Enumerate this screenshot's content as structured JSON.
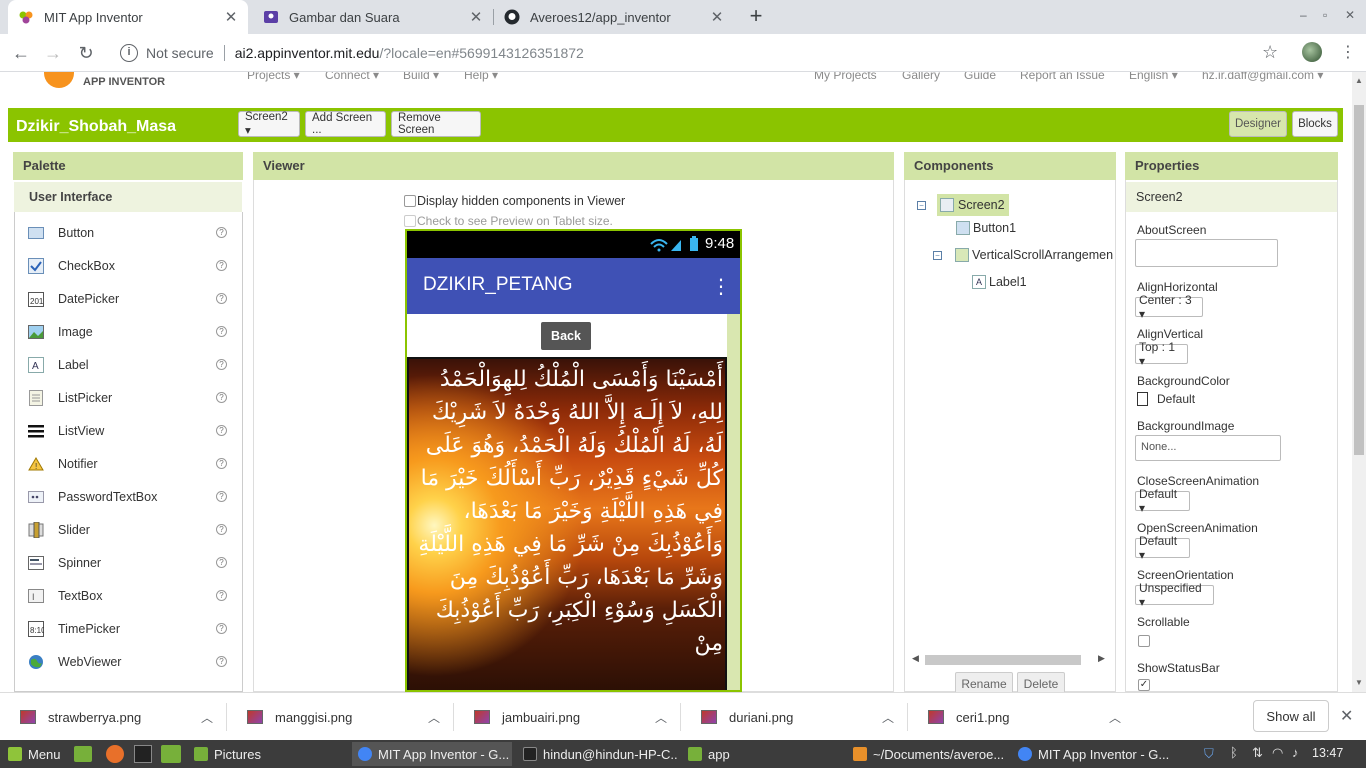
{
  "browser": {
    "tabs": [
      {
        "title": "MIT App Inventor",
        "active": true
      },
      {
        "title": "Gambar dan Suara",
        "active": false
      },
      {
        "title": "Averoes12/app_inventor",
        "active": false
      }
    ],
    "security_label": "Not secure",
    "url_host": "ai2.appinventor.mit.edu",
    "url_path": "/?locale=en#5699143126351872"
  },
  "app": {
    "logo_text": "APP INVENTOR",
    "menu_left": [
      "Projects ▾",
      "Connect ▾",
      "Build ▾",
      "Help ▾"
    ],
    "menu_right": [
      "My Projects",
      "Gallery",
      "Guide",
      "Report an Issue",
      "English ▾",
      "hz.ir.daff@gmail.com ▾"
    ],
    "project_name": "Dzikir_Shobah_Masa",
    "screen_select": "Screen2 ▾",
    "add_screen": "Add Screen ...",
    "remove_screen": "Remove Screen",
    "designer": "Designer",
    "blocks": "Blocks"
  },
  "palette": {
    "title": "Palette",
    "category": "User Interface",
    "items": [
      "Button",
      "CheckBox",
      "DatePicker",
      "Image",
      "Label",
      "ListPicker",
      "ListView",
      "Notifier",
      "PasswordTextBox",
      "Slider",
      "Spinner",
      "TextBox",
      "TimePicker",
      "WebViewer"
    ]
  },
  "viewer": {
    "title": "Viewer",
    "hidden_components": "Display hidden components in Viewer",
    "tablet_preview": "Check to see Preview on Tablet size.",
    "time": "9:48",
    "screen_title": "DZIKIR_PETANG",
    "back_button": "Back",
    "arabic_text": "أَمْسَيْنَا وَأَمْسَى الْمُلْكُ لِلهِوَالْحَمْدُ لِلهِ، لاَ إِلَـهَ إِلاَّ اللهُ وَحْدَهُ لاَ شَرِيْكَ لَهُ، لَهُ الْمُلْكُ وَلَهُ الْحَمْدُ، وَهُوَ عَلَى كُلِّ شَيْءٍ قَدِيْرٌ، رَبِّ أَسْأَلُكَ خَيْرَ مَا فِي هَذِهِ اللَّيْلَةِ وَخَيْرَ مَا بَعْدَهَا، وَأَعُوْذُبِكَ مِنْ شَرِّ مَا فِي هَذِهِ اللَّيْلَةِ وَشَرِّ مَا بَعْدَهَا، رَبِّ أَعُوْذُبِكَ مِنَ الْكَسَلِ وَسُوْءِ الْكِبَرِ، رَبِّ أَعُوْذُبِكَ مِنْ"
  },
  "components": {
    "title": "Components",
    "tree": [
      "Screen2",
      "Button1",
      "VerticalScrollArrangemen",
      "Label1"
    ],
    "rename": "Rename",
    "delete": "Delete"
  },
  "properties": {
    "title": "Properties",
    "screen": "Screen2",
    "about_screen": "AboutScreen",
    "align_horizontal": "AlignHorizontal",
    "align_horizontal_value": "Center : 3 ▾",
    "align_vertical": "AlignVertical",
    "align_vertical_value": "Top : 1 ▾",
    "background_color": "BackgroundColor",
    "background_color_value": "Default",
    "background_image": "BackgroundImage",
    "background_image_value": "None...",
    "close_anim": "CloseScreenAnimation",
    "close_anim_value": "Default ▾",
    "open_anim": "OpenScreenAnimation",
    "open_anim_value": "Default ▾",
    "orientation": "ScreenOrientation",
    "orientation_value": "Unspecified ▾",
    "scrollable": "Scrollable",
    "show_status_bar": "ShowStatusBar"
  },
  "downloads": {
    "files": [
      "strawberrya.png",
      "manggisi.png",
      "jambuairi.png",
      "duriani.png",
      "ceri1.png"
    ],
    "show_all": "Show all"
  },
  "taskbar": {
    "menu": "Menu",
    "windows": [
      "Pictures",
      "MIT App Inventor - G...",
      "hindun@hindun-HP-C...",
      "app",
      "~/Documents/averoe...",
      "MIT App Inventor - G..."
    ],
    "clock": "13:47"
  }
}
